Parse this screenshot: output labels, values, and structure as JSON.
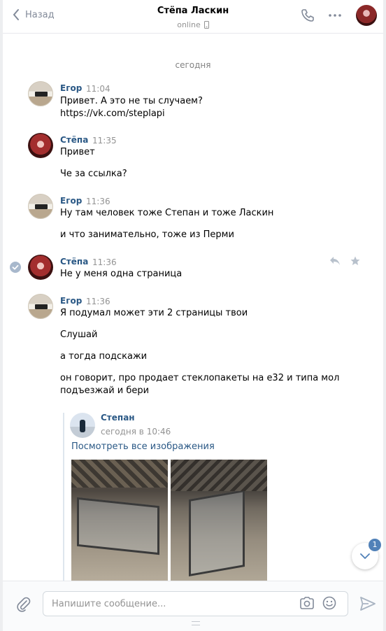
{
  "header": {
    "back_label": "Назад",
    "title": "Стёпа Ласкин",
    "status": "online"
  },
  "date_separator": "сегодня",
  "messages": [
    {
      "name": "Егор",
      "time": "11:04",
      "lines": [
        "Привет. А это не ты случаем?",
        "https://vk.com/steplapi"
      ]
    },
    {
      "name": "Стёпа",
      "time": "11:35",
      "lines": [
        "Привет",
        "Че за ссылка?"
      ]
    },
    {
      "name": "Егор",
      "time": "11:36",
      "lines": [
        "Ну там человек тоже Степан и тоже Ласкин",
        "и что занимательно, тоже из Перми"
      ]
    },
    {
      "name": "Стёпа",
      "time": "11:36",
      "lines": [
        "Не у меня одна страница"
      ]
    },
    {
      "name": "Егор",
      "time": "11:36",
      "lines": [
        "Я подумал может эти 2 страницы твои",
        "Слушай",
        "а тогда подскажи",
        "он говорит, про продает стеклопакеты на е32 и типа мол",
        "подъезжай и бери"
      ]
    }
  ],
  "forwarded": {
    "name": "Степан",
    "time": "сегодня в 10:46",
    "view_all": "Посмотреть все изображения"
  },
  "scroll_badge_count": "1",
  "composer": {
    "placeholder": "Напишите сообщение..."
  },
  "colors": {
    "link": "#2a5885",
    "accent": "#5181b8",
    "muted": "#939393"
  }
}
